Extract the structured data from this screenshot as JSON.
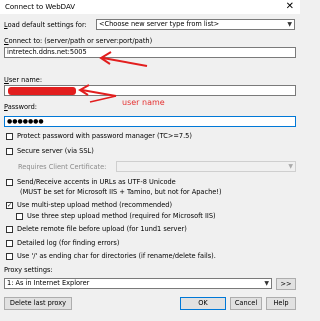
{
  "window": {
    "title": "Connect to WebDAV",
    "close_glyph": "✕"
  },
  "load_defaults": {
    "label_key": "L",
    "label_rest": "oad default settings for:",
    "value": "<Choose new server type from list>"
  },
  "connect": {
    "label_key": "C",
    "label_rest": "onnect to: (server/path or server:port/path)",
    "value": "intretech.ddns.net:5005"
  },
  "username": {
    "label_key": "U",
    "label_rest": "ser name:",
    "value": ""
  },
  "annotation": {
    "text": "user name",
    "color": "#e53030"
  },
  "password": {
    "label_key": "P",
    "label_rest": "assword:",
    "value": "●●●●●●●"
  },
  "options": [
    {
      "label": "Protect password with password manager (TC>=7.5)",
      "checked": false
    },
    {
      "label": "Secure server (via SSL)",
      "checked": false
    },
    {
      "label": "Send/Receive accents in URLs as UTF-8 Unicode",
      "sub": "(MUST be set for Microsoft IIS + Tamino, but not for Apache!)",
      "checked": false
    },
    {
      "label": "Use multi-step upload method (recommended)",
      "checked": true
    },
    {
      "label": "Use three step upload method (required for Microsoft IIS)",
      "checked": false
    },
    {
      "label": "Delete remote file before upload (for 1und1 server)",
      "checked": false
    },
    {
      "label": "Detailed log (for finding errors)",
      "checked": false
    },
    {
      "label": "Use '/' as ending char for directories (if rename/delete fails).",
      "checked": false
    }
  ],
  "client_cert": {
    "label": "Requires Client Certificate:",
    "value": ""
  },
  "proxy": {
    "label": "Proxy settings:",
    "value": "1: As in Internet Explorer",
    "more": ">>"
  },
  "buttons": {
    "delete_proxy": "Delete last proxy",
    "ok": "OK",
    "cancel": "Cancel",
    "help": "Help"
  },
  "check_glyph": "✓",
  "dropdown_glyph": "▼"
}
